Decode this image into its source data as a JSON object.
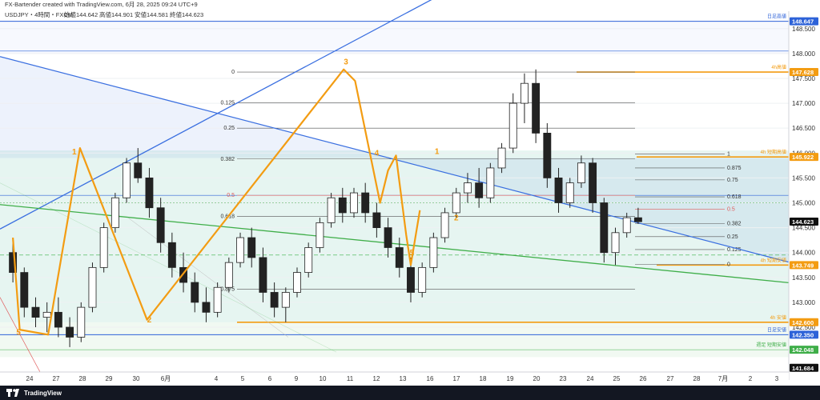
{
  "header": {
    "credit": "FX-Bartender created with TradingView.com, 6月 28, 2025 09:24 UTC+9",
    "symbol": "USDJPY・4時間・FXCM",
    "open": "始値144.642",
    "high": "高値144.901",
    "low": "安値144.581",
    "close": "終値144.623"
  },
  "footer": {
    "brand": "TradingView"
  },
  "colors": {
    "up": "#ffffff",
    "down": "#222222",
    "wave": "#f39c12",
    "trend_blue": "#3a6fe0",
    "trend_green": "#3fae49",
    "fib_line": "#555555",
    "tag_blue": "#2d62d8",
    "tag_orange": "#f39c12",
    "tag_green": "#3fae49",
    "tag_black": "#111111"
  },
  "chart_data": {
    "type": "candlestick",
    "ylim": [
      141.6,
      148.85
    ],
    "ytick_labels": [
      "148.500",
      "148.000",
      "147.500",
      "147.000",
      "146.500",
      "146.000",
      "145.500",
      "145.000",
      "144.500",
      "144.000",
      "143.500",
      "143.000",
      "142.500"
    ],
    "xtick_labels": [
      "24",
      "27",
      "28",
      "29",
      "30",
      "6月",
      "4",
      "5",
      "6",
      "9",
      "10",
      "11",
      "12",
      "13",
      "16",
      "17",
      "18",
      "19",
      "20",
      "23",
      "24",
      "25",
      "26",
      "27",
      "28",
      "7月",
      "2",
      "3"
    ],
    "price_tags": [
      {
        "label": "148.647",
        "value": 148.647,
        "color": "#2d62d8",
        "note": "日足高値"
      },
      {
        "label": "147.628",
        "value": 147.628,
        "color": "#f39c12",
        "note": "4h高値"
      },
      {
        "label": "145.922",
        "value": 145.922,
        "color": "#f39c12",
        "note": "4h 短期高値"
      },
      {
        "label": "144.623",
        "value": 144.623,
        "color": "#111111",
        "note": ""
      },
      {
        "label": "143.749",
        "value": 143.749,
        "color": "#f39c12",
        "note": "4h 短期安値"
      },
      {
        "label": "142.600",
        "value": 142.6,
        "color": "#f39c12",
        "note": "4h 安値"
      },
      {
        "label": "142.350",
        "value": 142.35,
        "color": "#2d62d8",
        "note": "日足安値"
      },
      {
        "label": "142.048",
        "value": 142.048,
        "color": "#3fae49",
        "note": "週足 短期安値"
      },
      {
        "label": "141.684",
        "value": 141.684,
        "color": "#111111",
        "note": ""
      }
    ],
    "fib_left": {
      "levels": [
        {
          "label": "0",
          "value": 147.628
        },
        {
          "label": "0.125",
          "value": 147.01
        },
        {
          "label": "0.25",
          "value": 146.5
        },
        {
          "label": "0.382",
          "value": 145.88
        },
        {
          "label": "0.5",
          "value": 145.15
        },
        {
          "label": "0.618",
          "value": 144.73
        },
        {
          "label": "0.875",
          "value": 143.26
        }
      ]
    },
    "fib_right": {
      "levels": [
        {
          "label": "1",
          "value": 145.98
        },
        {
          "label": "0.875",
          "value": 145.7
        },
        {
          "label": "0.75",
          "value": 145.46
        },
        {
          "label": "0.618",
          "value": 145.12
        },
        {
          "label": "0.5",
          "value": 144.87
        },
        {
          "label": "0.382",
          "value": 144.58
        },
        {
          "label": "0.25",
          "value": 144.32
        },
        {
          "label": "0.125",
          "value": 144.06
        },
        {
          "label": "0",
          "value": 143.76
        }
      ]
    },
    "wave_labels": [
      {
        "label": "5",
        "x": 0.5,
        "y": 142.35
      },
      {
        "label": "1",
        "x": 5.4,
        "y": 145.97
      },
      {
        "label": "2",
        "x": 12.0,
        "y": 142.6
      },
      {
        "label": "3",
        "x": 29.3,
        "y": 147.78
      },
      {
        "label": "4",
        "x": 32.0,
        "y": 145.95
      },
      {
        "label": "5",
        "x": 35.1,
        "y": 143.95
      },
      {
        "label": "1",
        "x": 37.3,
        "y": 145.98
      },
      {
        "label": "2",
        "x": 39.0,
        "y": 144.65
      }
    ],
    "wave_points": [
      [
        0,
        144.3
      ],
      [
        0.6,
        142.45
      ],
      [
        3.1,
        142.35
      ],
      [
        5.9,
        146.1
      ],
      [
        11.8,
        142.65
      ],
      [
        29.1,
        147.68
      ],
      [
        30.1,
        147.45
      ],
      [
        32.3,
        145.0
      ],
      [
        33.0,
        145.65
      ],
      [
        33.7,
        145.95
      ],
      [
        34.6,
        144.35
      ],
      [
        35.0,
        143.75
      ],
      [
        35.8,
        144.85
      ]
    ],
    "trendlines": [
      {
        "name": "upper_down",
        "color": "#3a6fe0",
        "from": [
          0,
          147.9
        ],
        "to": [
          42,
          145.4
        ]
      },
      {
        "name": "upper_up",
        "color": "#3a6fe0",
        "from": [
          0,
          144.55
        ],
        "to": [
          35,
          148.8
        ]
      },
      {
        "name": "green_down",
        "color": "#3fae49",
        "from": [
          0,
          144.95
        ],
        "to": [
          42,
          144.0
        ]
      }
    ],
    "candles": [
      [
        144.0,
        144.2,
        143.4,
        143.6
      ],
      [
        143.6,
        143.7,
        142.7,
        142.9
      ],
      [
        142.9,
        143.1,
        142.5,
        142.7
      ],
      [
        142.7,
        143.0,
        142.4,
        142.8
      ],
      [
        142.8,
        143.1,
        142.3,
        142.5
      ],
      [
        142.5,
        142.7,
        142.1,
        142.3
      ],
      [
        142.3,
        143.0,
        142.2,
        142.9
      ],
      [
        142.9,
        143.8,
        142.8,
        143.7
      ],
      [
        143.7,
        144.6,
        143.6,
        144.5
      ],
      [
        144.5,
        145.2,
        144.4,
        145.1
      ],
      [
        145.1,
        145.9,
        145.0,
        145.8
      ],
      [
        145.8,
        146.1,
        145.4,
        145.5
      ],
      [
        145.5,
        145.7,
        144.7,
        144.9
      ],
      [
        144.9,
        145.1,
        144.0,
        144.2
      ],
      [
        144.2,
        144.4,
        143.5,
        143.7
      ],
      [
        143.7,
        144.0,
        143.2,
        143.4
      ],
      [
        143.4,
        143.6,
        142.8,
        143.0
      ],
      [
        143.0,
        143.3,
        142.6,
        142.8
      ],
      [
        142.8,
        143.4,
        142.7,
        143.3
      ],
      [
        143.3,
        143.9,
        143.2,
        143.8
      ],
      [
        143.8,
        144.4,
        143.7,
        144.3
      ],
      [
        144.3,
        144.5,
        143.7,
        143.9
      ],
      [
        143.9,
        144.1,
        143.0,
        143.2
      ],
      [
        143.2,
        143.4,
        142.7,
        142.9
      ],
      [
        142.9,
        143.3,
        142.6,
        143.2
      ],
      [
        143.2,
        143.7,
        143.1,
        143.6
      ],
      [
        143.6,
        144.2,
        143.5,
        144.1
      ],
      [
        144.1,
        144.7,
        144.0,
        144.6
      ],
      [
        144.6,
        145.2,
        144.5,
        145.1
      ],
      [
        145.1,
        145.3,
        144.6,
        144.8
      ],
      [
        144.8,
        145.3,
        144.7,
        145.2
      ],
      [
        145.2,
        145.4,
        144.6,
        144.8
      ],
      [
        144.8,
        145.0,
        144.3,
        144.5
      ],
      [
        144.5,
        144.7,
        143.9,
        144.1
      ],
      [
        144.1,
        144.3,
        143.5,
        143.7
      ],
      [
        143.7,
        143.9,
        143.0,
        143.2
      ],
      [
        143.2,
        143.8,
        143.1,
        143.7
      ],
      [
        143.7,
        144.4,
        143.6,
        144.3
      ],
      [
        144.3,
        144.9,
        144.2,
        144.8
      ],
      [
        144.8,
        145.3,
        144.7,
        145.2
      ],
      [
        145.2,
        145.6,
        145.0,
        145.4
      ],
      [
        145.4,
        145.7,
        144.9,
        145.1
      ],
      [
        145.1,
        145.8,
        145.0,
        145.7
      ],
      [
        145.7,
        146.2,
        145.6,
        146.1
      ],
      [
        146.1,
        147.2,
        146.0,
        147.0
      ],
      [
        147.0,
        147.6,
        146.6,
        147.4
      ],
      [
        147.4,
        147.68,
        146.2,
        146.4
      ],
      [
        146.4,
        146.6,
        145.3,
        145.5
      ],
      [
        145.5,
        145.7,
        144.8,
        145.0
      ],
      [
        145.0,
        145.5,
        144.9,
        145.4
      ],
      [
        145.4,
        145.95,
        145.3,
        145.8
      ],
      [
        145.8,
        145.9,
        144.8,
        145.0
      ],
      [
        145.0,
        145.1,
        143.8,
        144.0
      ],
      [
        144.0,
        144.5,
        143.75,
        144.4
      ],
      [
        144.4,
        144.8,
        144.3,
        144.7
      ],
      [
        144.7,
        144.9,
        144.58,
        144.62
      ]
    ]
  }
}
